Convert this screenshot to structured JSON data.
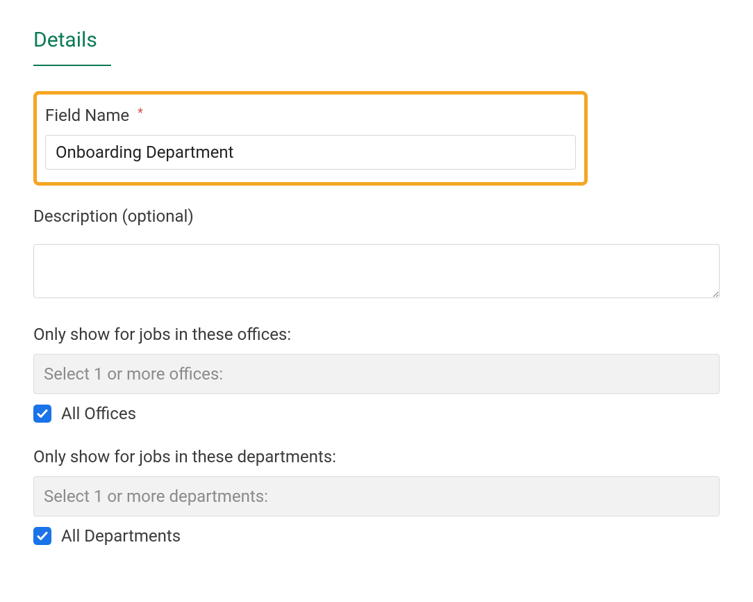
{
  "section": {
    "title": "Details"
  },
  "fieldName": {
    "label": "Field Name",
    "value": "Onboarding Department"
  },
  "description": {
    "label": "Description (optional)",
    "value": ""
  },
  "offices": {
    "label": "Only show for jobs in these offices:",
    "placeholder": "Select 1 or more offices:",
    "checkboxLabel": "All Offices",
    "checked": true
  },
  "departments": {
    "label": "Only show for jobs in these departments:",
    "placeholder": "Select 1 or more departments:",
    "checkboxLabel": "All Departments",
    "checked": true
  }
}
